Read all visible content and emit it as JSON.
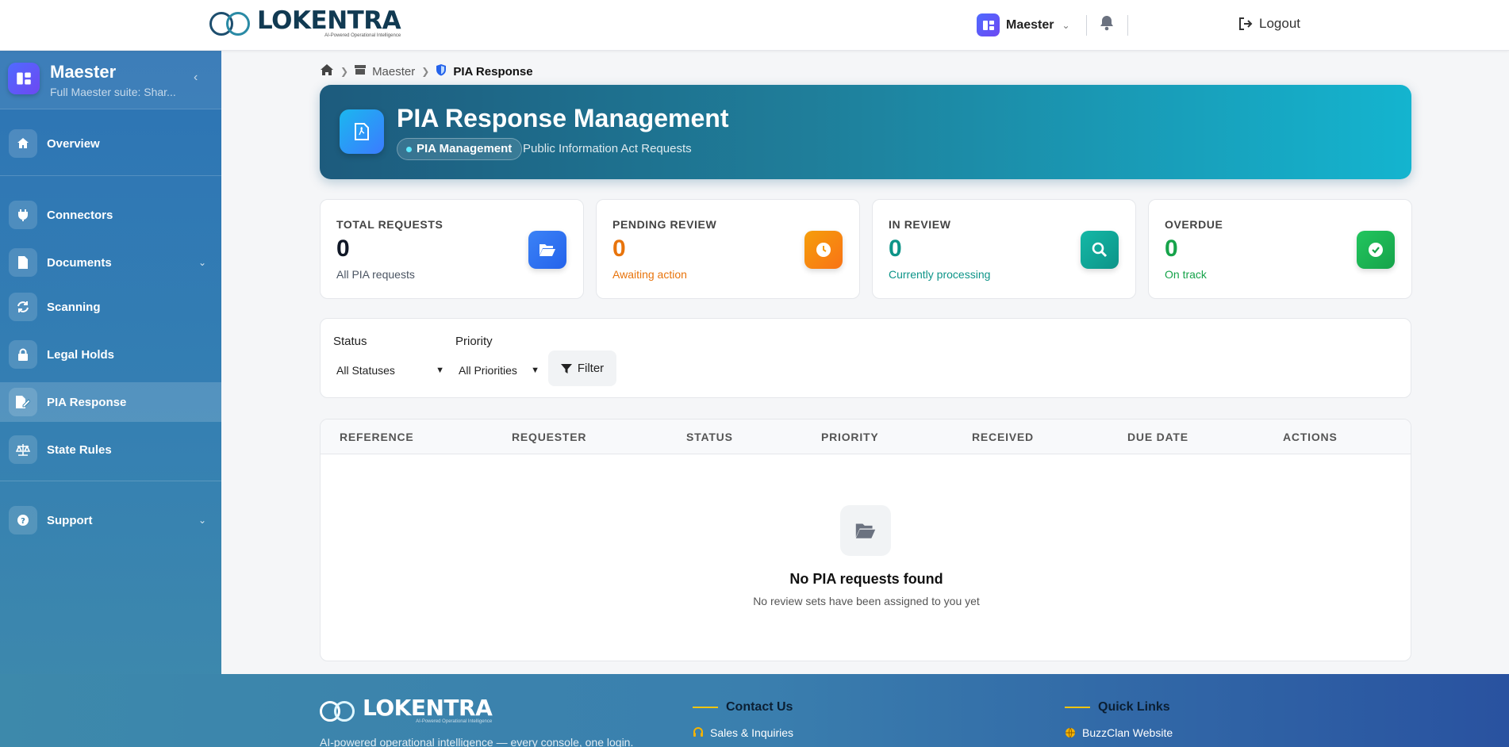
{
  "brand": {
    "name": "LOKENTRA",
    "tagline": "AI-Powered Operational Intelligence"
  },
  "topbar": {
    "user_label": "Maester",
    "logout_label": "Logout"
  },
  "sidebar": {
    "title": "Maester",
    "subtitle": "Full Maester suite: Shar...",
    "items": [
      {
        "label": "Overview",
        "icon": "home-icon"
      },
      {
        "label": "Connectors",
        "icon": "plug-icon"
      },
      {
        "label": "Documents",
        "icon": "file-icon"
      },
      {
        "label": "Scanning",
        "icon": "refresh-icon"
      },
      {
        "label": "Legal Holds",
        "icon": "lock-icon"
      },
      {
        "label": "PIA Response",
        "icon": "file-edit-icon",
        "active": true
      },
      {
        "label": "State Rules",
        "icon": "scale-icon"
      },
      {
        "label": "Support",
        "icon": "help-icon"
      }
    ]
  },
  "breadcrumb": {
    "level1": "Maester",
    "current": "PIA Response"
  },
  "hero": {
    "title": "PIA Response Management",
    "badge": "PIA Management",
    "subtitle": "Public Information Act Requests"
  },
  "stats": [
    {
      "label": "TOTAL REQUESTS",
      "value": "0",
      "sub": "All PIA requests",
      "color": "#111827",
      "sub_color": "#4b5563",
      "icon": "folder-open-icon",
      "icon_bg": "#3b82f6"
    },
    {
      "label": "PENDING REVIEW",
      "value": "0",
      "sub": "Awaiting action",
      "color": "#e8740c",
      "sub_color": "#e8740c",
      "icon": "clock-icon",
      "icon_bg": "#f59e0b"
    },
    {
      "label": "IN REVIEW",
      "value": "0",
      "sub": "Currently processing",
      "color": "#0d9488",
      "sub_color": "#0d9488",
      "icon": "search-icon",
      "icon_bg": "#14b8a6"
    },
    {
      "label": "OVERDUE",
      "value": "0",
      "sub": "On track",
      "color": "#16a34a",
      "sub_color": "#16a34a",
      "icon": "check-circle-icon",
      "icon_bg": "#22c55e"
    }
  ],
  "filters": {
    "status_label": "Status",
    "status_value": "All Statuses",
    "priority_label": "Priority",
    "priority_value": "All Priorities",
    "filter_button": "Filter"
  },
  "table": {
    "columns": [
      "REFERENCE",
      "REQUESTER",
      "STATUS",
      "PRIORITY",
      "RECEIVED",
      "DUE DATE",
      "ACTIONS"
    ],
    "empty_title": "No PIA requests found",
    "empty_subtitle": "No review sets have been assigned to you yet"
  },
  "footer": {
    "description": "AI-powered operational intelligence — every console, one login.",
    "contact_title": "Contact Us",
    "contact_link": "Sales & Inquiries",
    "links_title": "Quick Links",
    "links_link": "BuzzClan Website"
  }
}
